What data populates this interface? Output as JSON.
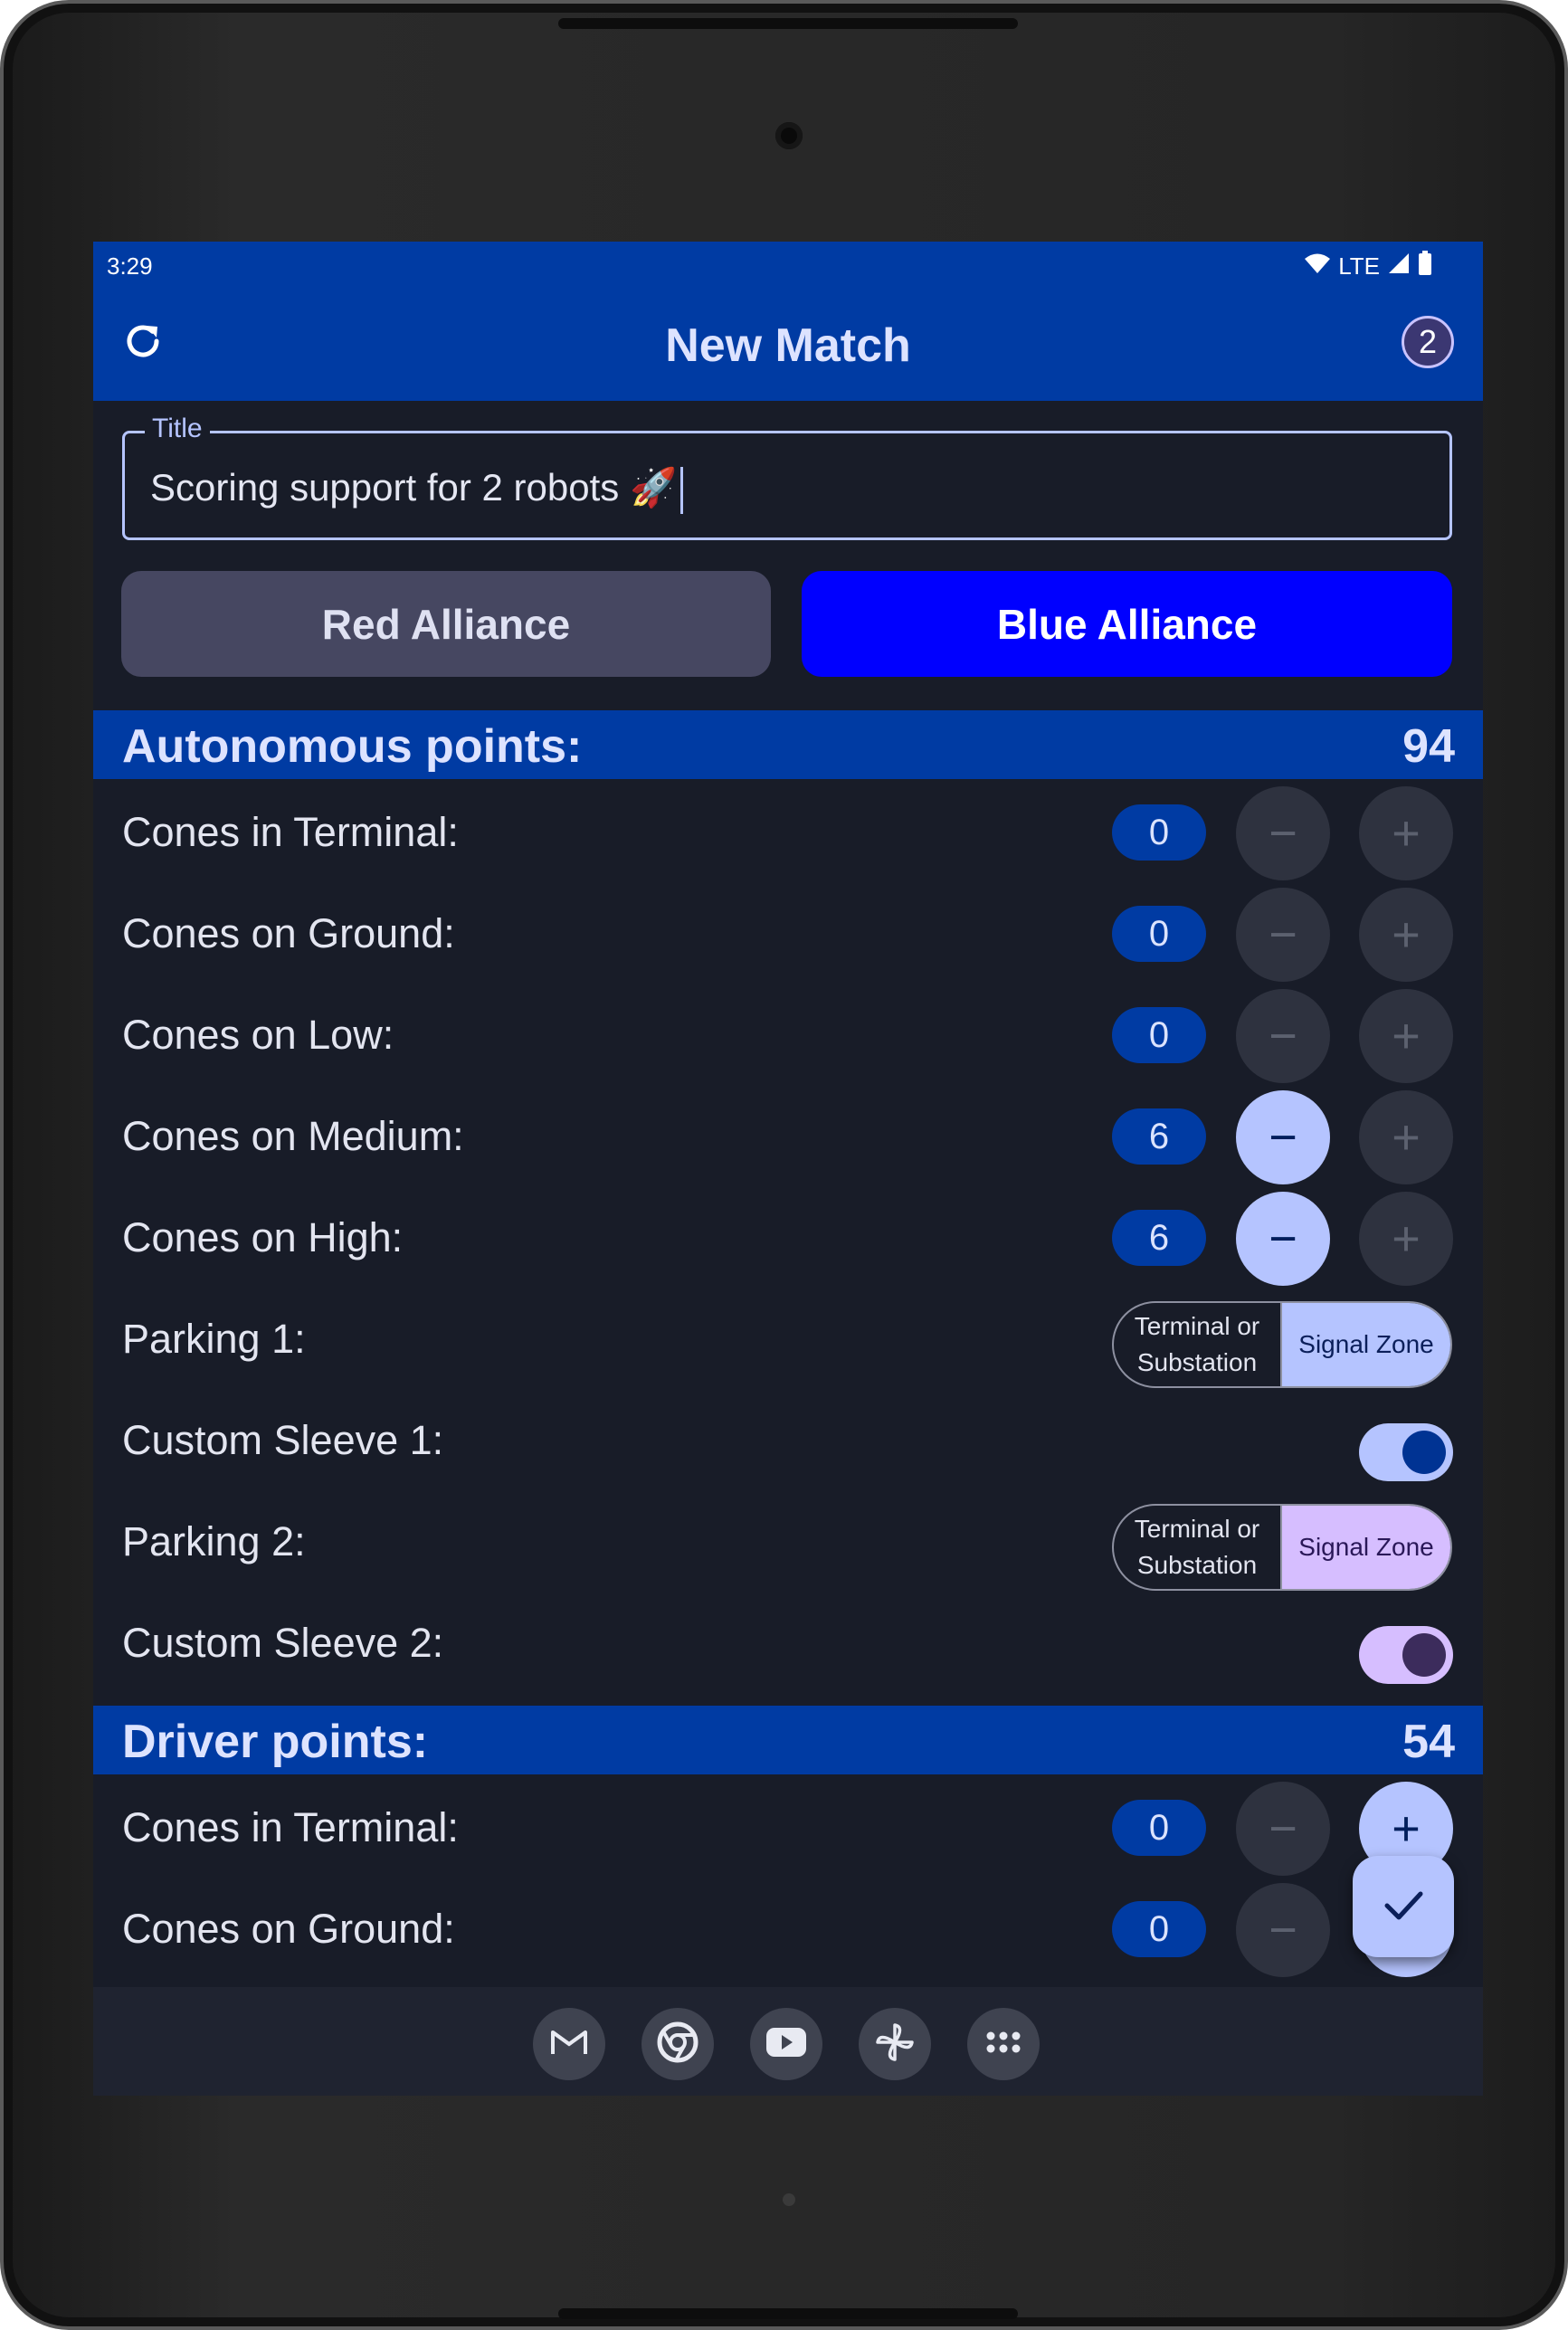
{
  "status_bar": {
    "time": "3:29",
    "network": "LTE",
    "icons": [
      "wifi-icon",
      "cell-signal-icon",
      "battery-icon"
    ]
  },
  "app_bar": {
    "title": "New Match",
    "refresh_icon": "refresh-icon",
    "badge_count": "2"
  },
  "title_field": {
    "label": "Title",
    "value": "Scoring support for 2 robots 🚀"
  },
  "alliance": {
    "red_label": "Red Alliance",
    "blue_label": "Blue Alliance",
    "selected": "Blue Alliance"
  },
  "autonomous": {
    "header": "Autonomous points:",
    "total": "94",
    "counters": [
      {
        "label": "Cones in Terminal:",
        "value": "0"
      },
      {
        "label": "Cones on Ground:",
        "value": "0"
      },
      {
        "label": "Cones on Low:",
        "value": "0"
      },
      {
        "label": "Cones on Medium:",
        "value": "6"
      },
      {
        "label": "Cones on High:",
        "value": "6"
      }
    ],
    "parking_1": {
      "label": "Parking 1:",
      "option_a": "Terminal or Substation",
      "option_b": "Signal Zone",
      "selected": "Signal Zone"
    },
    "sleeve_1": {
      "label": "Custom Sleeve 1:",
      "on": true
    },
    "parking_2": {
      "label": "Parking 2:",
      "option_a": "Terminal or Substation",
      "option_b": "Signal Zone",
      "selected": "Signal Zone"
    },
    "sleeve_2": {
      "label": "Custom Sleeve 2:",
      "on": true
    }
  },
  "driver": {
    "header": "Driver points:",
    "total": "54",
    "counters": [
      {
        "label": "Cones in Terminal:",
        "value": "0"
      },
      {
        "label": "Cones on Ground:",
        "value": "0"
      }
    ]
  },
  "buttons": {
    "minus": "−",
    "plus": "+"
  },
  "dock": [
    "gmail-icon",
    "chrome-icon",
    "youtube-icon",
    "pinwheel-icon",
    "app-drawer-icon"
  ],
  "colors": {
    "primary": "#003ba3",
    "blue_alliance": "#0000ff",
    "background": "#181c28",
    "accent": "#b5c4ff",
    "accent_purple": "#d6beff"
  }
}
